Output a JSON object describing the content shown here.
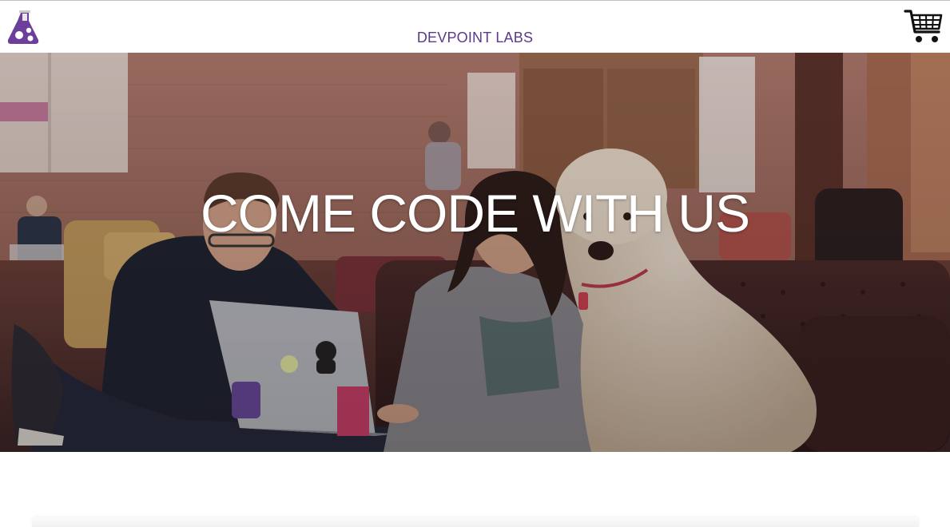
{
  "header": {
    "brand": "DEVPOINT LABS",
    "logo_icon": "flask-logo-icon",
    "cart_icon": "shopping-cart-icon",
    "brand_color": "#5b3a8c"
  },
  "hero": {
    "title": "COME CODE WITH US",
    "title_color": "#ffffff"
  }
}
